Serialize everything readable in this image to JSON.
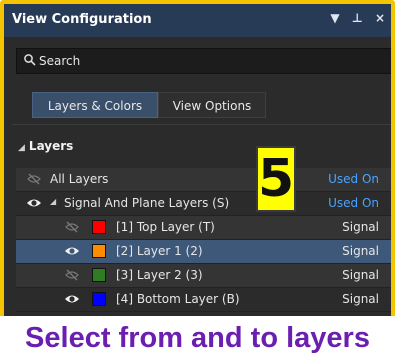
{
  "window": {
    "title": "View Configuration",
    "controls": [
      "▼",
      "⊥",
      "×"
    ]
  },
  "search": {
    "placeholder": "Search"
  },
  "tabs": [
    {
      "label": "Layers & Colors",
      "active": true
    },
    {
      "label": "View Options",
      "active": false
    }
  ],
  "section": {
    "title": "Layers"
  },
  "rows": [
    {
      "label": "All Layers",
      "value": "Used On",
      "visible": false,
      "expand": ""
    },
    {
      "label": "Signal And Plane Layers (S)",
      "value": "Used On",
      "visible": true,
      "expand": "◢"
    },
    {
      "label": "[1] Top Layer (T)",
      "value": "Signal",
      "visible": false,
      "color": "#ff0000"
    },
    {
      "label": "[2] Layer 1 (2)",
      "value": "Signal",
      "visible": true,
      "color": "#ff8c00",
      "selected": true
    },
    {
      "label": "[3] Layer 2 (3)",
      "value": "Signal",
      "visible": false,
      "color": "#2e7d23"
    },
    {
      "label": "[4] Bottom Layer (B)",
      "value": "Signal",
      "visible": true,
      "color": "#0000ff"
    }
  ],
  "overlay": {
    "step": "5",
    "caption": "Select from and to layers"
  }
}
